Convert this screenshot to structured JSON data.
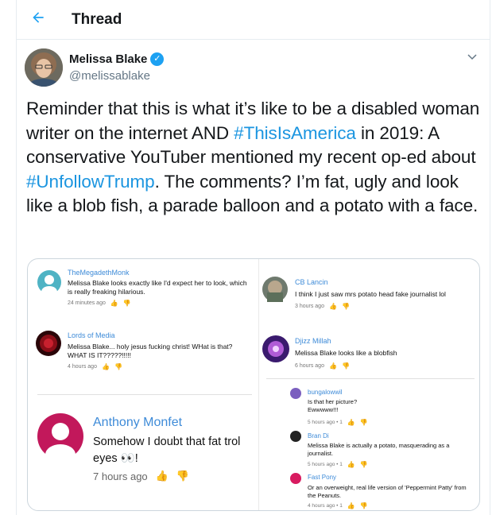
{
  "header": {
    "title": "Thread",
    "back_icon": "arrow-left-icon"
  },
  "author": {
    "name": "Melissa Blake",
    "handle": "@melissablake",
    "verified": true
  },
  "tweet": {
    "parts": [
      "Reminder that this is what it’s like to be a disabled woman writer on the internet AND ",
      "#ThisIsAmerica",
      " in 2019: A conservative YouTuber mentioned my recent op-ed about ",
      "#UnfollowTrump",
      ". The comments? I’m fat, ugly and look like a blob fish, a parade balloon and a potato with a face."
    ]
  },
  "comments": {
    "c1": {
      "name": "TheMegadethMonk",
      "text": "Melissa Blake looks exactly like I'd expect her to look, which is really freaking hilarious.",
      "meta": "24 minutes ago"
    },
    "c2": {
      "name": "Lords of Media",
      "text": "Melissa Blake... holy jesus fucking christ! WHat is that? WHAT IS IT?????!!!!!",
      "meta": "4 hours ago"
    },
    "c3": {
      "name": "Anthony Monfet",
      "text": "Somehow I doubt that fat trol eyes 👀!",
      "meta": "7 hours ago"
    },
    "c4": {
      "name": "CB Lancin",
      "text": "I think I just saw mrs potato head fake journalist lol",
      "meta": "3 hours ago"
    },
    "c5": {
      "name": "Djizz Millah",
      "text": "Melissa Blake looks like a blobfish",
      "meta": "6 hours ago"
    },
    "c6": {
      "name": "bungalowwil",
      "text": "Is that her picture? Ewwwww!!!",
      "meta": "5 hours ago • 1"
    },
    "c7": {
      "name": "Bran Di",
      "text": "Melissa Blake is actually a potato, masquerading as a journalist.",
      "meta": "5 hours ago • 1"
    },
    "c8": {
      "name": "Fast Pony",
      "text": "Or an overweight, real life version of 'Peppermint Patty' from the Peanuts.",
      "meta": "4 hours ago • 1"
    }
  },
  "colors": {
    "link": "#1b95e0",
    "accent": "#1da1f2",
    "comment_name": "#3e8bd8"
  }
}
